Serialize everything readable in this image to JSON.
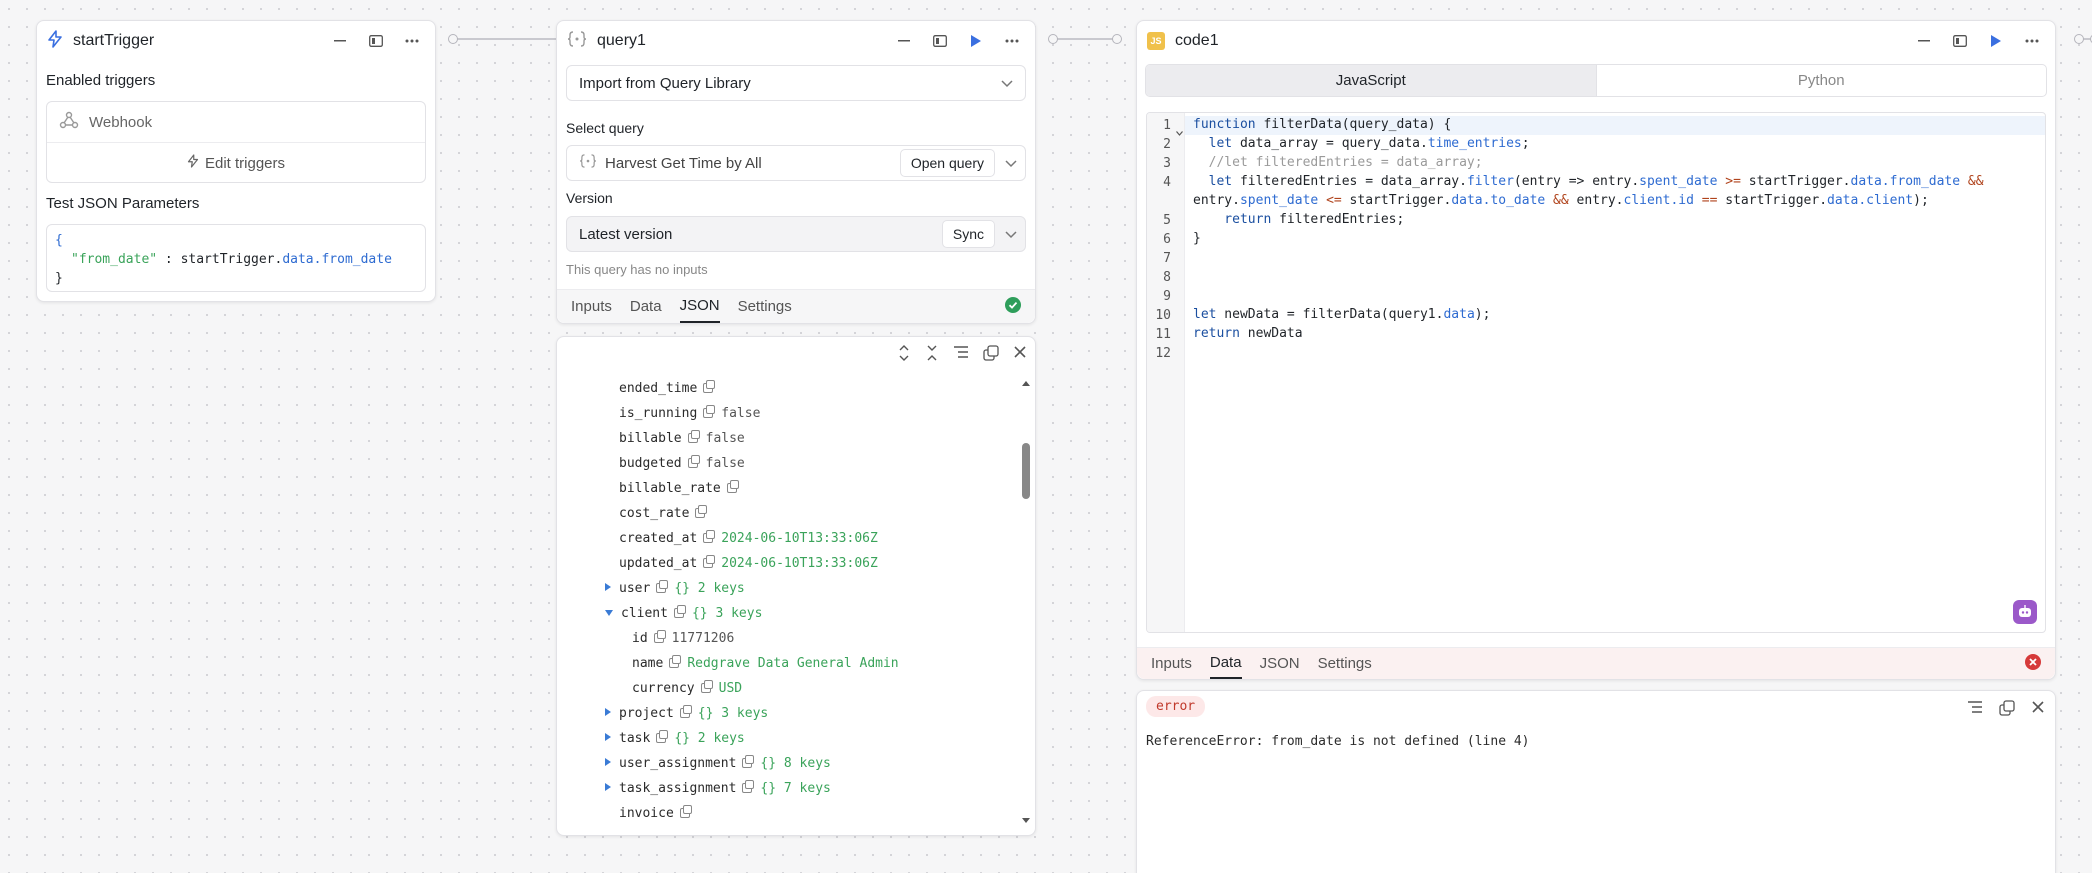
{
  "trigger": {
    "title": "startTrigger",
    "enabled_label": "Enabled triggers",
    "webhook_label": "Webhook",
    "edit_label": "Edit triggers",
    "test_label": "Test JSON Parameters",
    "json_open": "{",
    "json_key": "\"from_date\"",
    "json_sep": " : ",
    "json_obj": "startTrigger.",
    "json_prop": "data.from_date",
    "json_close": "}"
  },
  "query": {
    "title": "query1",
    "import_label": "Import from Query Library",
    "select_label": "Select query",
    "selected_query": "Harvest Get Time by All",
    "open_label": "Open query",
    "version_label": "Version",
    "version_value": "Latest version",
    "sync_label": "Sync",
    "no_inputs": "This query has no inputs",
    "tabs": [
      "Inputs",
      "Data",
      "JSON",
      "Settings"
    ],
    "active_tab": "JSON",
    "json_rows": [
      {
        "key": "ended_time",
        "value": ""
      },
      {
        "key": "is_running",
        "value": "false"
      },
      {
        "key": "billable",
        "value": "false"
      },
      {
        "key": "budgeted",
        "value": "false"
      },
      {
        "key": "billable_rate",
        "value": ""
      },
      {
        "key": "cost_rate",
        "value": ""
      },
      {
        "key": "created_at",
        "value": "2024-06-10T13:33:06Z"
      },
      {
        "key": "updated_at",
        "value": "2024-06-10T13:33:06Z"
      },
      {
        "key": "user",
        "value": "{} 2 keys"
      },
      {
        "key": "client",
        "value": "{} 3 keys"
      },
      {
        "key": "id",
        "value": "11771206"
      },
      {
        "key": "name",
        "value": "Redgrave Data General Admin"
      },
      {
        "key": "currency",
        "value": "USD"
      },
      {
        "key": "project",
        "value": "{} 3 keys"
      },
      {
        "key": "task",
        "value": "{} 2 keys"
      },
      {
        "key": "user_assignment",
        "value": "{} 8 keys"
      },
      {
        "key": "task_assignment",
        "value": "{} 7 keys"
      },
      {
        "key": "invoice",
        "value": ""
      }
    ]
  },
  "code": {
    "title": "code1",
    "js_badge": "JS",
    "lang_js": "JavaScript",
    "lang_py": "Python",
    "tabs": [
      "Inputs",
      "Data",
      "JSON",
      "Settings"
    ],
    "active_tab": "Data",
    "error_badge": "error",
    "error_message": "ReferenceError: from_date is not defined (line 4)",
    "line_numbers": [
      "1",
      "2",
      "3",
      "4",
      "",
      "5",
      "6",
      "7",
      "8",
      "9",
      "10",
      "11",
      "12"
    ],
    "l1a": "function",
    "l1b": " filterData(query_data) {",
    "l2a": "  let",
    "l2b": " data_array = query_data.",
    "l2c": "time_entries",
    "l2d": ";",
    "l3": "  //let filteredEntries = data_array;",
    "l4a": "  let",
    "l4b": " filteredEntries = data_array.",
    "l4c": "filter",
    "l4d": "(entry => entry.",
    "l4e": "spent_date",
    "l4f": " >=",
    "l4g": " startTrigger.",
    "l4h": "data.from_date",
    "l4i": " &&",
    "l4j": "entry.",
    "l4k": "spent_date",
    "l4l": " <=",
    "l4m": " startTrigger.",
    "l4n": "data.to_date",
    "l4o": " &&",
    "l4p": " entry.",
    "l4q": "client.id",
    "l4r": " ==",
    "l4s": " startTrigger.",
    "l4t": "data.client",
    "l4u": ");",
    "l5a": "    return",
    "l5b": " filteredEntries;",
    "l6": "}",
    "l10a": "let",
    "l10b": " newData = filterData(query1.",
    "l10c": "data",
    "l10d": ");",
    "l11a": "return",
    "l11b": " newData"
  }
}
